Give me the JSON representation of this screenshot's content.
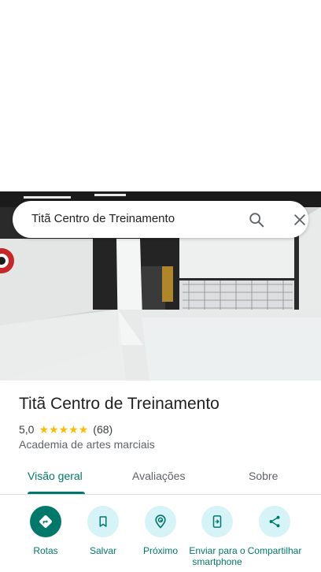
{
  "search": {
    "query": "Titã Centro de Treinamento",
    "search_icon": "search-icon",
    "close_icon": "close-icon"
  },
  "place": {
    "title": "Titã Centro de Treinamento",
    "rating": "5,0",
    "rating_stars": 5,
    "review_count": "(68)",
    "category": "Academia de artes marciais"
  },
  "tabs": [
    {
      "label": "Visão geral",
      "active": true
    },
    {
      "label": "Avaliações",
      "active": false
    },
    {
      "label": "Sobre",
      "active": false
    }
  ],
  "actions": [
    {
      "label": "Rotas",
      "icon": "directions-icon"
    },
    {
      "label": "Salvar",
      "icon": "bookmark-icon"
    },
    {
      "label": "Próximo",
      "icon": "nearby-icon"
    },
    {
      "label": "Enviar para o smartphone",
      "icon": "send-to-phone-icon"
    },
    {
      "label": "Compartilhar",
      "icon": "share-icon"
    }
  ],
  "colors": {
    "accent": "#00796b",
    "action_bg": "#d6f3f8",
    "star": "#fbbc04"
  }
}
